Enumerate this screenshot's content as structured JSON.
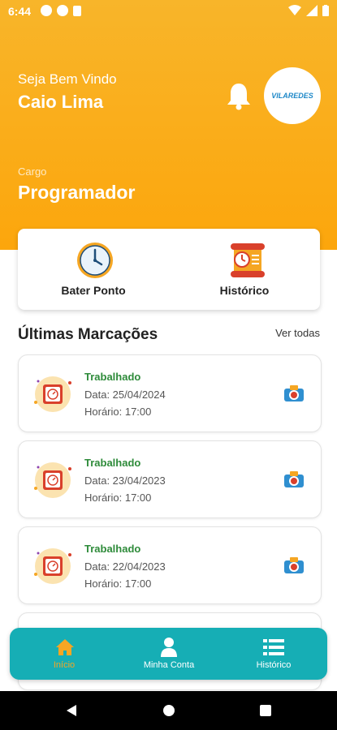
{
  "status_bar": {
    "time": "6:44"
  },
  "header": {
    "welcome": "Seja Bem Vindo",
    "username": "Caio Lima",
    "cargo_label": "Cargo",
    "cargo_value": "Programador",
    "logo_text": "VILAREDES"
  },
  "actions": [
    {
      "label": "Bater Ponto",
      "icon": "clock-icon"
    },
    {
      "label": "Histórico",
      "icon": "scroll-icon"
    }
  ],
  "latest": {
    "title": "Últimas Marcações",
    "see_all": "Ver todas"
  },
  "records": [
    {
      "status": "Trabalhado",
      "date": "Data: 25/04/2024",
      "time": "Horário: 17:00"
    },
    {
      "status": "Trabalhado",
      "date": "Data: 23/04/2023",
      "time": "Horário: 17:00"
    },
    {
      "status": "Trabalhado",
      "date": "Data: 22/04/2023",
      "time": "Horário: 17:00"
    }
  ],
  "nav": [
    {
      "label": "Início",
      "icon": "home-icon",
      "active": true
    },
    {
      "label": "Minha Conta",
      "icon": "user-icon",
      "active": false
    },
    {
      "label": "Histórico",
      "icon": "list-icon",
      "active": false
    }
  ],
  "colors": {
    "header": "#fca60c",
    "nav": "#16aeb5",
    "active": "#f5a623",
    "status_green": "#2e8b3a"
  }
}
